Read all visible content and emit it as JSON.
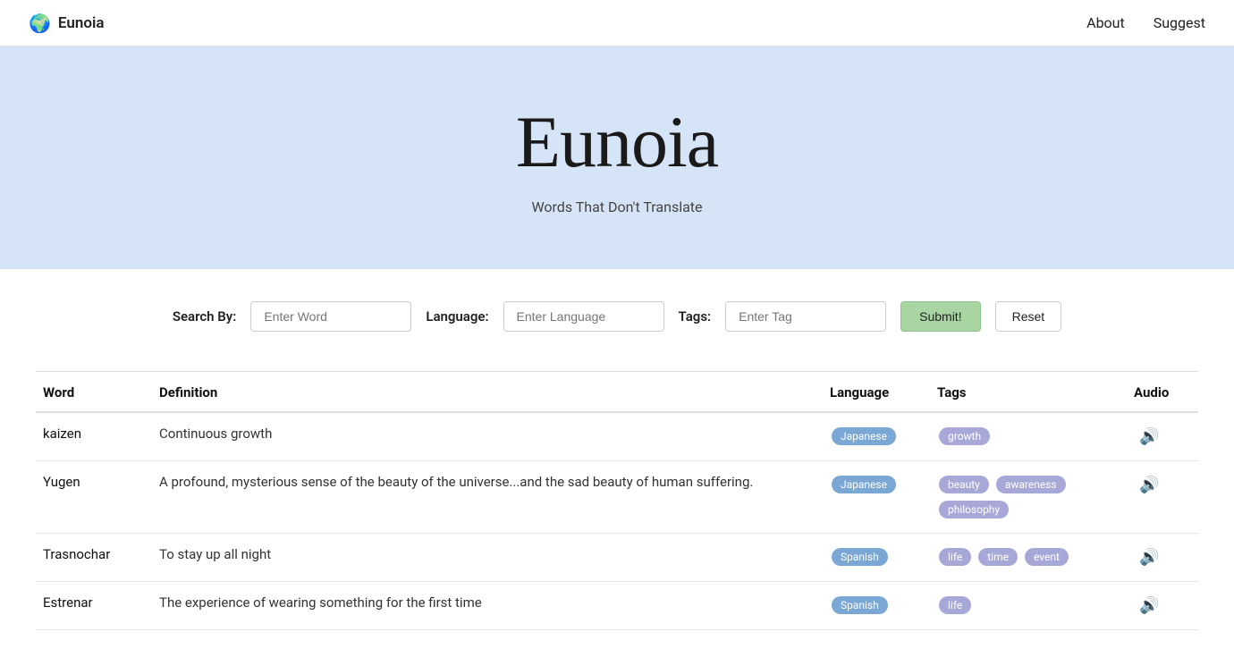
{
  "nav": {
    "brand": "Eunoia",
    "globe_icon": "🌍",
    "links": [
      {
        "label": "About",
        "href": "#"
      },
      {
        "label": "Suggest",
        "href": "#"
      }
    ]
  },
  "hero": {
    "title": "Eunoia",
    "subtitle": "Words That Don't Translate"
  },
  "search": {
    "search_by_label": "Search By:",
    "search_by_placeholder": "Enter Word",
    "language_label": "Language:",
    "language_placeholder": "Enter Language",
    "tags_label": "Tags:",
    "tags_placeholder": "Enter Tag",
    "submit_label": "Submit!",
    "reset_label": "Reset"
  },
  "table": {
    "columns": [
      "Word",
      "Definition",
      "Language",
      "Tags",
      "Audio"
    ],
    "rows": [
      {
        "word": "kaizen",
        "definition": "Continuous growth",
        "language": "Japanese",
        "tags": [
          "growth"
        ],
        "has_audio": true
      },
      {
        "word": "Yugen",
        "definition": "A profound, mysterious sense of the beauty of the universe...and the sad beauty of human suffering.",
        "language": "Japanese",
        "tags": [
          "beauty",
          "awareness",
          "philosophy"
        ],
        "has_audio": true
      },
      {
        "word": "Trasnochar",
        "definition": "To stay up all night",
        "language": "Spanish",
        "tags": [
          "life",
          "time",
          "event"
        ],
        "has_audio": true
      },
      {
        "word": "Estrenar",
        "definition": "The experience of wearing something for the first time",
        "language": "Spanish",
        "tags": [
          "life"
        ],
        "has_audio": true
      }
    ]
  }
}
